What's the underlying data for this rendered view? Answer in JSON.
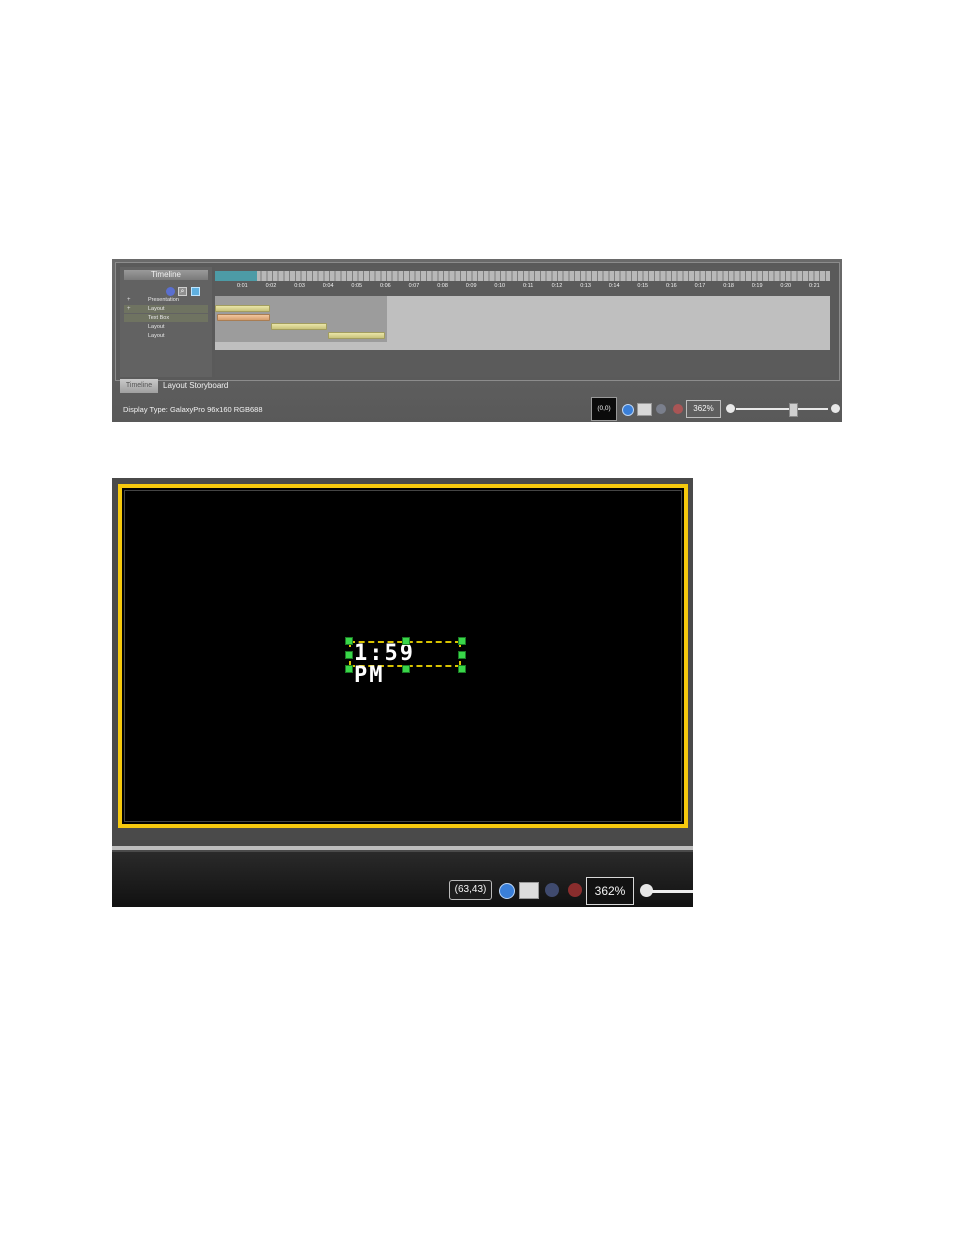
{
  "timeline_panel": {
    "title": "Timeline",
    "layers": [
      {
        "expander": "+",
        "label": "Presentation"
      },
      {
        "expander": "+",
        "label": "Layout"
      },
      {
        "expander": "",
        "label": "Text Box"
      },
      {
        "expander": "",
        "label": "Layout"
      },
      {
        "expander": "",
        "label": "Layout"
      }
    ],
    "tick_labels": [
      "0:01",
      "0:02",
      "0:03",
      "0:04",
      "0:05",
      "0:06",
      "0:07",
      "0:08",
      "0:09",
      "0:10",
      "0:11",
      "0:12",
      "0:13",
      "0:14",
      "0:15",
      "0:16",
      "0:17",
      "0:18",
      "0:19",
      "0:20",
      "0:21"
    ],
    "tabs": {
      "timeline": "Timeline",
      "storyboard": "Layout Storyboard"
    },
    "display_type": "Display Type:  GalaxyPro 96x160 RGB688",
    "coordinates": "(0,0)",
    "zoom": "362%"
  },
  "canvas_panel": {
    "textbox_text": "1:59 PM",
    "coordinates": "(63,43)",
    "zoom": "362%"
  },
  "colors": {
    "canvas_border": "#f6c90e",
    "handle": "#39d649",
    "play": "#3a7fd8",
    "stop": "#b93a3a"
  },
  "icons": [
    "view-icon",
    "zoom-icon",
    "grid-icon",
    "play-icon",
    "export-icon",
    "pause-icon",
    "stop-icon",
    "zoom-out-icon",
    "zoom-in-icon"
  ]
}
